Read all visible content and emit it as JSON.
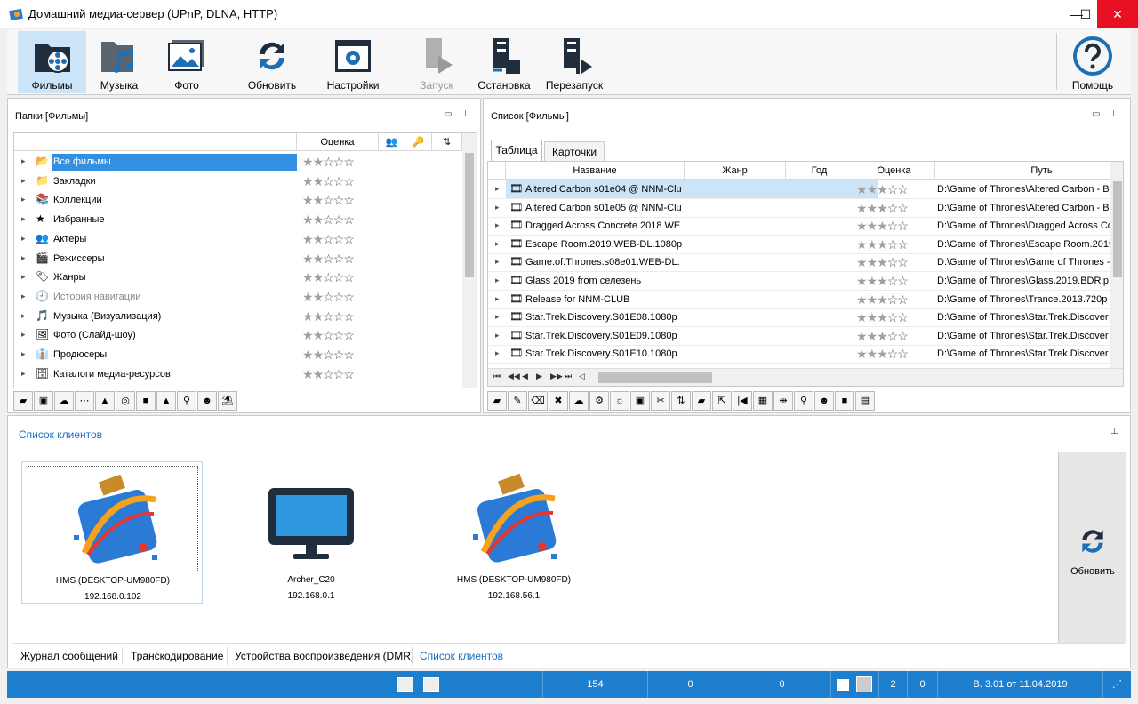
{
  "window": {
    "title": "Домашний медиа-сервер (UPnP, DLNA, HTTP)",
    "minimize": "—",
    "maximize": "☐",
    "close": "✕"
  },
  "toolbar": {
    "films": "Фильмы",
    "music": "Музыка",
    "photo": "Фото",
    "refresh": "Обновить",
    "settings": "Настройки",
    "start": "Запуск",
    "stop": "Остановка",
    "restart": "Перезапуск",
    "help": "Помощь"
  },
  "folders": {
    "title": "Папки [Фильмы]",
    "col_rating": "Оценка",
    "items": [
      {
        "label": "Все фильмы",
        "rating": 2
      },
      {
        "label": "Закладки",
        "rating": 2
      },
      {
        "label": "Коллекции",
        "rating": 2
      },
      {
        "label": "Избранные",
        "rating": 2
      },
      {
        "label": "Актеры",
        "rating": 2
      },
      {
        "label": "Режиссеры",
        "rating": 2
      },
      {
        "label": "Жанры",
        "rating": 2
      },
      {
        "label": "История навигации",
        "rating": 2
      },
      {
        "label": "Музыка (Визуализация)",
        "rating": 2
      },
      {
        "label": "Фото (Слайд-шоу)",
        "rating": 2
      },
      {
        "label": "Продюсеры",
        "rating": 2
      },
      {
        "label": "Каталоги медиа-ресурсов",
        "rating": 2
      }
    ]
  },
  "list": {
    "title": "Список [Фильмы]",
    "tabs": [
      "Таблица",
      "Карточки"
    ],
    "columns": [
      "Название",
      "Жанр",
      "Год",
      "Оценка",
      "Путь"
    ],
    "rows": [
      {
        "name": "Altered Carbon s01e04 @ NNM-Clu",
        "path": "D:\\Game of Thrones\\Altered Carbon - B"
      },
      {
        "name": "Altered Carbon s01e05 @ NNM-Clu",
        "path": "D:\\Game of Thrones\\Altered Carbon - B"
      },
      {
        "name": "Dragged Across Concrete 2018 WE",
        "path": "D:\\Game of Thrones\\Dragged Across Co"
      },
      {
        "name": "Escape Room.2019.WEB-DL.1080p",
        "path": "D:\\Game of Thrones\\Escape Room.2019"
      },
      {
        "name": "Game.of.Thrones.s08e01.WEB-DL.",
        "path": "D:\\Game of Thrones\\Game of Thrones -"
      },
      {
        "name": "Glass 2019 from селезень",
        "path": "D:\\Game of Thrones\\Glass.2019.BDRip."
      },
      {
        "name": "Release for NNM-CLUB",
        "path": "D:\\Game of Thrones\\Trance.2013.720p"
      },
      {
        "name": "Star.Trek.Discovery.S01E08.1080p",
        "path": "D:\\Game of Thrones\\Star.Trek.Discover"
      },
      {
        "name": "Star.Trek.Discovery.S01E09.1080p",
        "path": "D:\\Game of Thrones\\Star.Trek.Discover"
      },
      {
        "name": "Star.Trek.Discovery.S01E10.1080p",
        "path": "D:\\Game of Thrones\\Star.Trek.Discover"
      }
    ],
    "nav": [
      "⏮",
      "◀◀",
      "◀",
      "▶",
      "▶▶",
      "⏭",
      "◁"
    ]
  },
  "clients": {
    "title": "Список клиентов",
    "items": [
      {
        "name": "HMS (DESKTOP-UM980FD)",
        "ip": "192.168.0.102"
      },
      {
        "name": "Archer_C20",
        "ip": "192.168.0.1"
      },
      {
        "name": "HMS (DESKTOP-UM980FD)",
        "ip": "192.168.56.1"
      }
    ],
    "refresh": "Обновить"
  },
  "bottom_tabs": [
    "Журнал сообщений",
    "Транскодирование",
    "Устройства воспроизведения (DMR)",
    "Список клиентов"
  ],
  "status": {
    "count": "154",
    "a": "0",
    "b": "0",
    "c": "2",
    "d": "0",
    "version": "В. 3.01 от 11.04.2019"
  },
  "colors": {
    "accent": "#1e7fce",
    "selection": "#cce4f7",
    "close": "#e81123"
  }
}
